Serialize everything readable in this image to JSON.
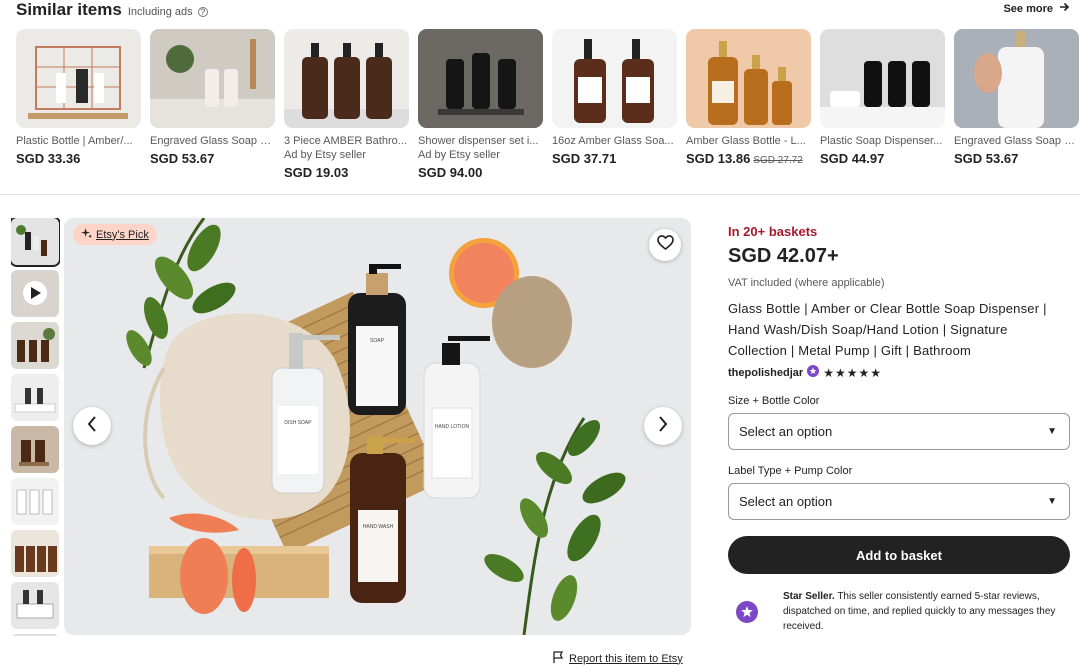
{
  "similar": {
    "title": "Similar items",
    "subtitle": "Including ads",
    "see_more": "See more",
    "items": [
      {
        "name": "Plastic Bottle | Amber/...",
        "ad": "",
        "price": "SGD 33.36",
        "old": ""
      },
      {
        "name": "Engraved Glass Soap D...",
        "ad": "",
        "price": "SGD 53.67",
        "old": ""
      },
      {
        "name": "3 Piece AMBER Bathro...",
        "ad": "Ad by Etsy seller",
        "price": "SGD 19.03",
        "old": ""
      },
      {
        "name": "Shower dispenser set i...",
        "ad": "Ad by Etsy seller",
        "price": "SGD 94.00",
        "old": ""
      },
      {
        "name": "16oz Amber Glass Soa...",
        "ad": "",
        "price": "SGD 37.71",
        "old": ""
      },
      {
        "name": "Amber Glass Bottle - L...",
        "ad": "",
        "price": "SGD 13.86",
        "old": "SGD 27.72"
      },
      {
        "name": "Plastic Soap Dispenser...",
        "ad": "",
        "price": "SGD 44.97",
        "old": ""
      },
      {
        "name": "Engraved Glass Soap D...",
        "ad": "",
        "price": "SGD 53.67",
        "old": ""
      }
    ]
  },
  "gallery": {
    "badge": "Etsy's Pick",
    "report": "Report this item to Etsy",
    "bottle_labels": [
      "DISH SOAP",
      "SOAP",
      "HAND LOTION",
      "HAND WASH"
    ]
  },
  "product": {
    "baskets": "In 20+ baskets",
    "price": "SGD 42.07+",
    "vat": "VAT included (where applicable)",
    "title": "Glass Bottle | Amber or Clear Bottle Soap Dispenser | Hand Wash/Dish Soap/Hand Lotion | Signature Collection | Metal Pump | Gift | Bathroom",
    "shop": "thepolishedjar",
    "rating": 5,
    "stars": "★★★★★",
    "option1_label": "Size + Bottle Color",
    "option1_value": "Select an option",
    "option2_label": "Label Type + Pump Color",
    "option2_value": "Select an option",
    "add_button": "Add to basket",
    "star_seller_title": "Star Seller.",
    "star_seller_text": "This seller consistently earned 5-star reviews, dispatched on time, and replied quickly to any messages they received."
  },
  "colors": {
    "baskets": "#a61a2e",
    "button": "#222222",
    "badge_bg": "#fcd5c8",
    "star_seller": "#7c48c7"
  }
}
